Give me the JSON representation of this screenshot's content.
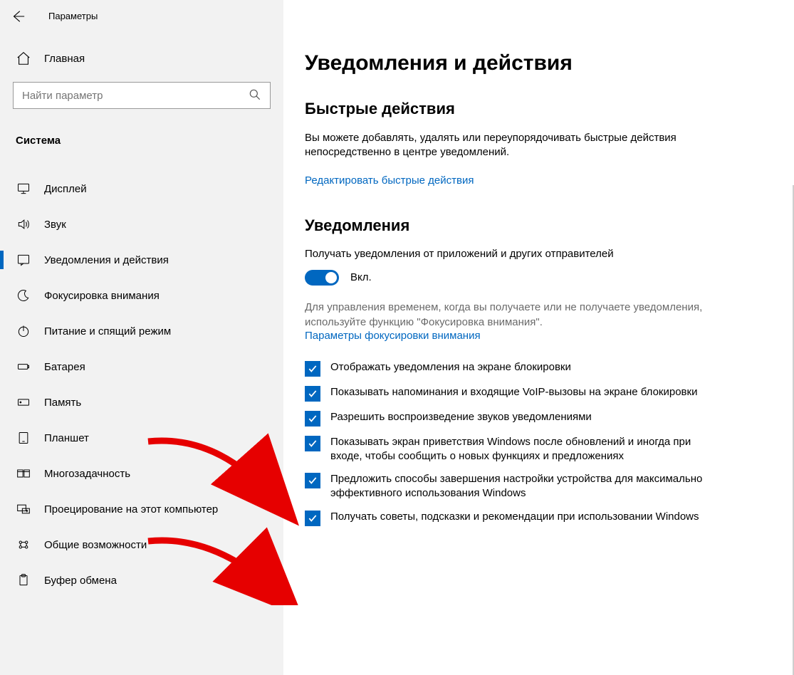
{
  "header": {
    "title": "Параметры"
  },
  "home": {
    "label": "Главная"
  },
  "search": {
    "placeholder": "Найти параметр"
  },
  "section": {
    "label": "Система"
  },
  "nav": {
    "items": [
      {
        "label": "Дисплей",
        "icon": "monitor"
      },
      {
        "label": "Звук",
        "icon": "sound"
      },
      {
        "label": "Уведомления и действия",
        "icon": "notification",
        "active": true
      },
      {
        "label": "Фокусировка внимания",
        "icon": "moon"
      },
      {
        "label": "Питание и спящий режим",
        "icon": "power"
      },
      {
        "label": "Батарея",
        "icon": "battery"
      },
      {
        "label": "Память",
        "icon": "storage"
      },
      {
        "label": "Планшет",
        "icon": "tablet"
      },
      {
        "label": "Многозадачность",
        "icon": "multitask"
      },
      {
        "label": "Проецирование на этот компьютер",
        "icon": "project"
      },
      {
        "label": "Общие возможности",
        "icon": "shared"
      },
      {
        "label": "Буфер обмена",
        "icon": "clipboard"
      }
    ]
  },
  "main": {
    "title": "Уведомления и действия",
    "quick_actions": {
      "heading": "Быстрые действия",
      "description": "Вы можете добавлять, удалять или переупорядочивать быстрые действия непосредственно в центре уведомлений.",
      "edit_link": "Редактировать быстрые действия"
    },
    "notifications": {
      "heading": "Уведомления",
      "receive_label": "Получать уведомления от приложений и других отправителей",
      "toggle_state": "Вкл.",
      "focus_note": "Для управления временем, когда вы получаете или не получаете уведомления, используйте функцию \"Фокусировка внимания\".",
      "focus_link": "Параметры фокусировки внимания",
      "checkboxes": [
        {
          "label": "Отображать уведомления на экране блокировки",
          "checked": true
        },
        {
          "label": "Показывать напоминания и входящие VoIP-вызовы на экране блокировки",
          "checked": true
        },
        {
          "label": "Разрешить  воспроизведение звуков уведомлениями",
          "checked": true
        },
        {
          "label": "Показывать экран приветствия Windows после обновлений и иногда при входе, чтобы сообщить о новых функциях и предложениях",
          "checked": true
        },
        {
          "label": "Предложить способы завершения настройки устройства для максимально эффективного использования Windows",
          "checked": true
        },
        {
          "label": "Получать советы, подсказки и рекомендации при использовании Windows",
          "checked": true
        }
      ]
    }
  },
  "annotations": {
    "arrow1_target": "checkbox-3",
    "arrow2_target": "checkbox-5"
  }
}
